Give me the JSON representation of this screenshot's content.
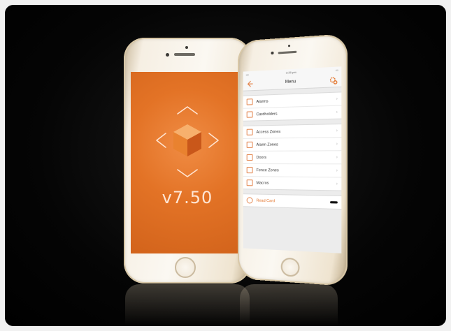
{
  "left_phone": {
    "version": "v7.50",
    "logo_icon": "cube-icon"
  },
  "right_phone": {
    "status_time": "3:25 pm",
    "nav_title": "Menu",
    "back_icon": "back-arrow-icon",
    "settings_icon": "gear-icon",
    "groups": [
      [
        {
          "label": "Alarms",
          "icon": "alarm-icon"
        },
        {
          "label": "Cardholders",
          "icon": "cardholder-icon"
        }
      ],
      [
        {
          "label": "Access Zones",
          "icon": "access-zone-icon"
        },
        {
          "label": "Alarm Zones",
          "icon": "alarm-zone-icon"
        },
        {
          "label": "Doors",
          "icon": "door-icon"
        },
        {
          "label": "Fence Zones",
          "icon": "fence-icon"
        },
        {
          "label": "Macros",
          "icon": "macro-icon"
        }
      ]
    ],
    "read_card": {
      "label": "Read Card",
      "icon": "nfc-icon"
    }
  },
  "colors": {
    "accent": "#e37326",
    "background": "#000000",
    "phone_body": "#f6efe3"
  }
}
